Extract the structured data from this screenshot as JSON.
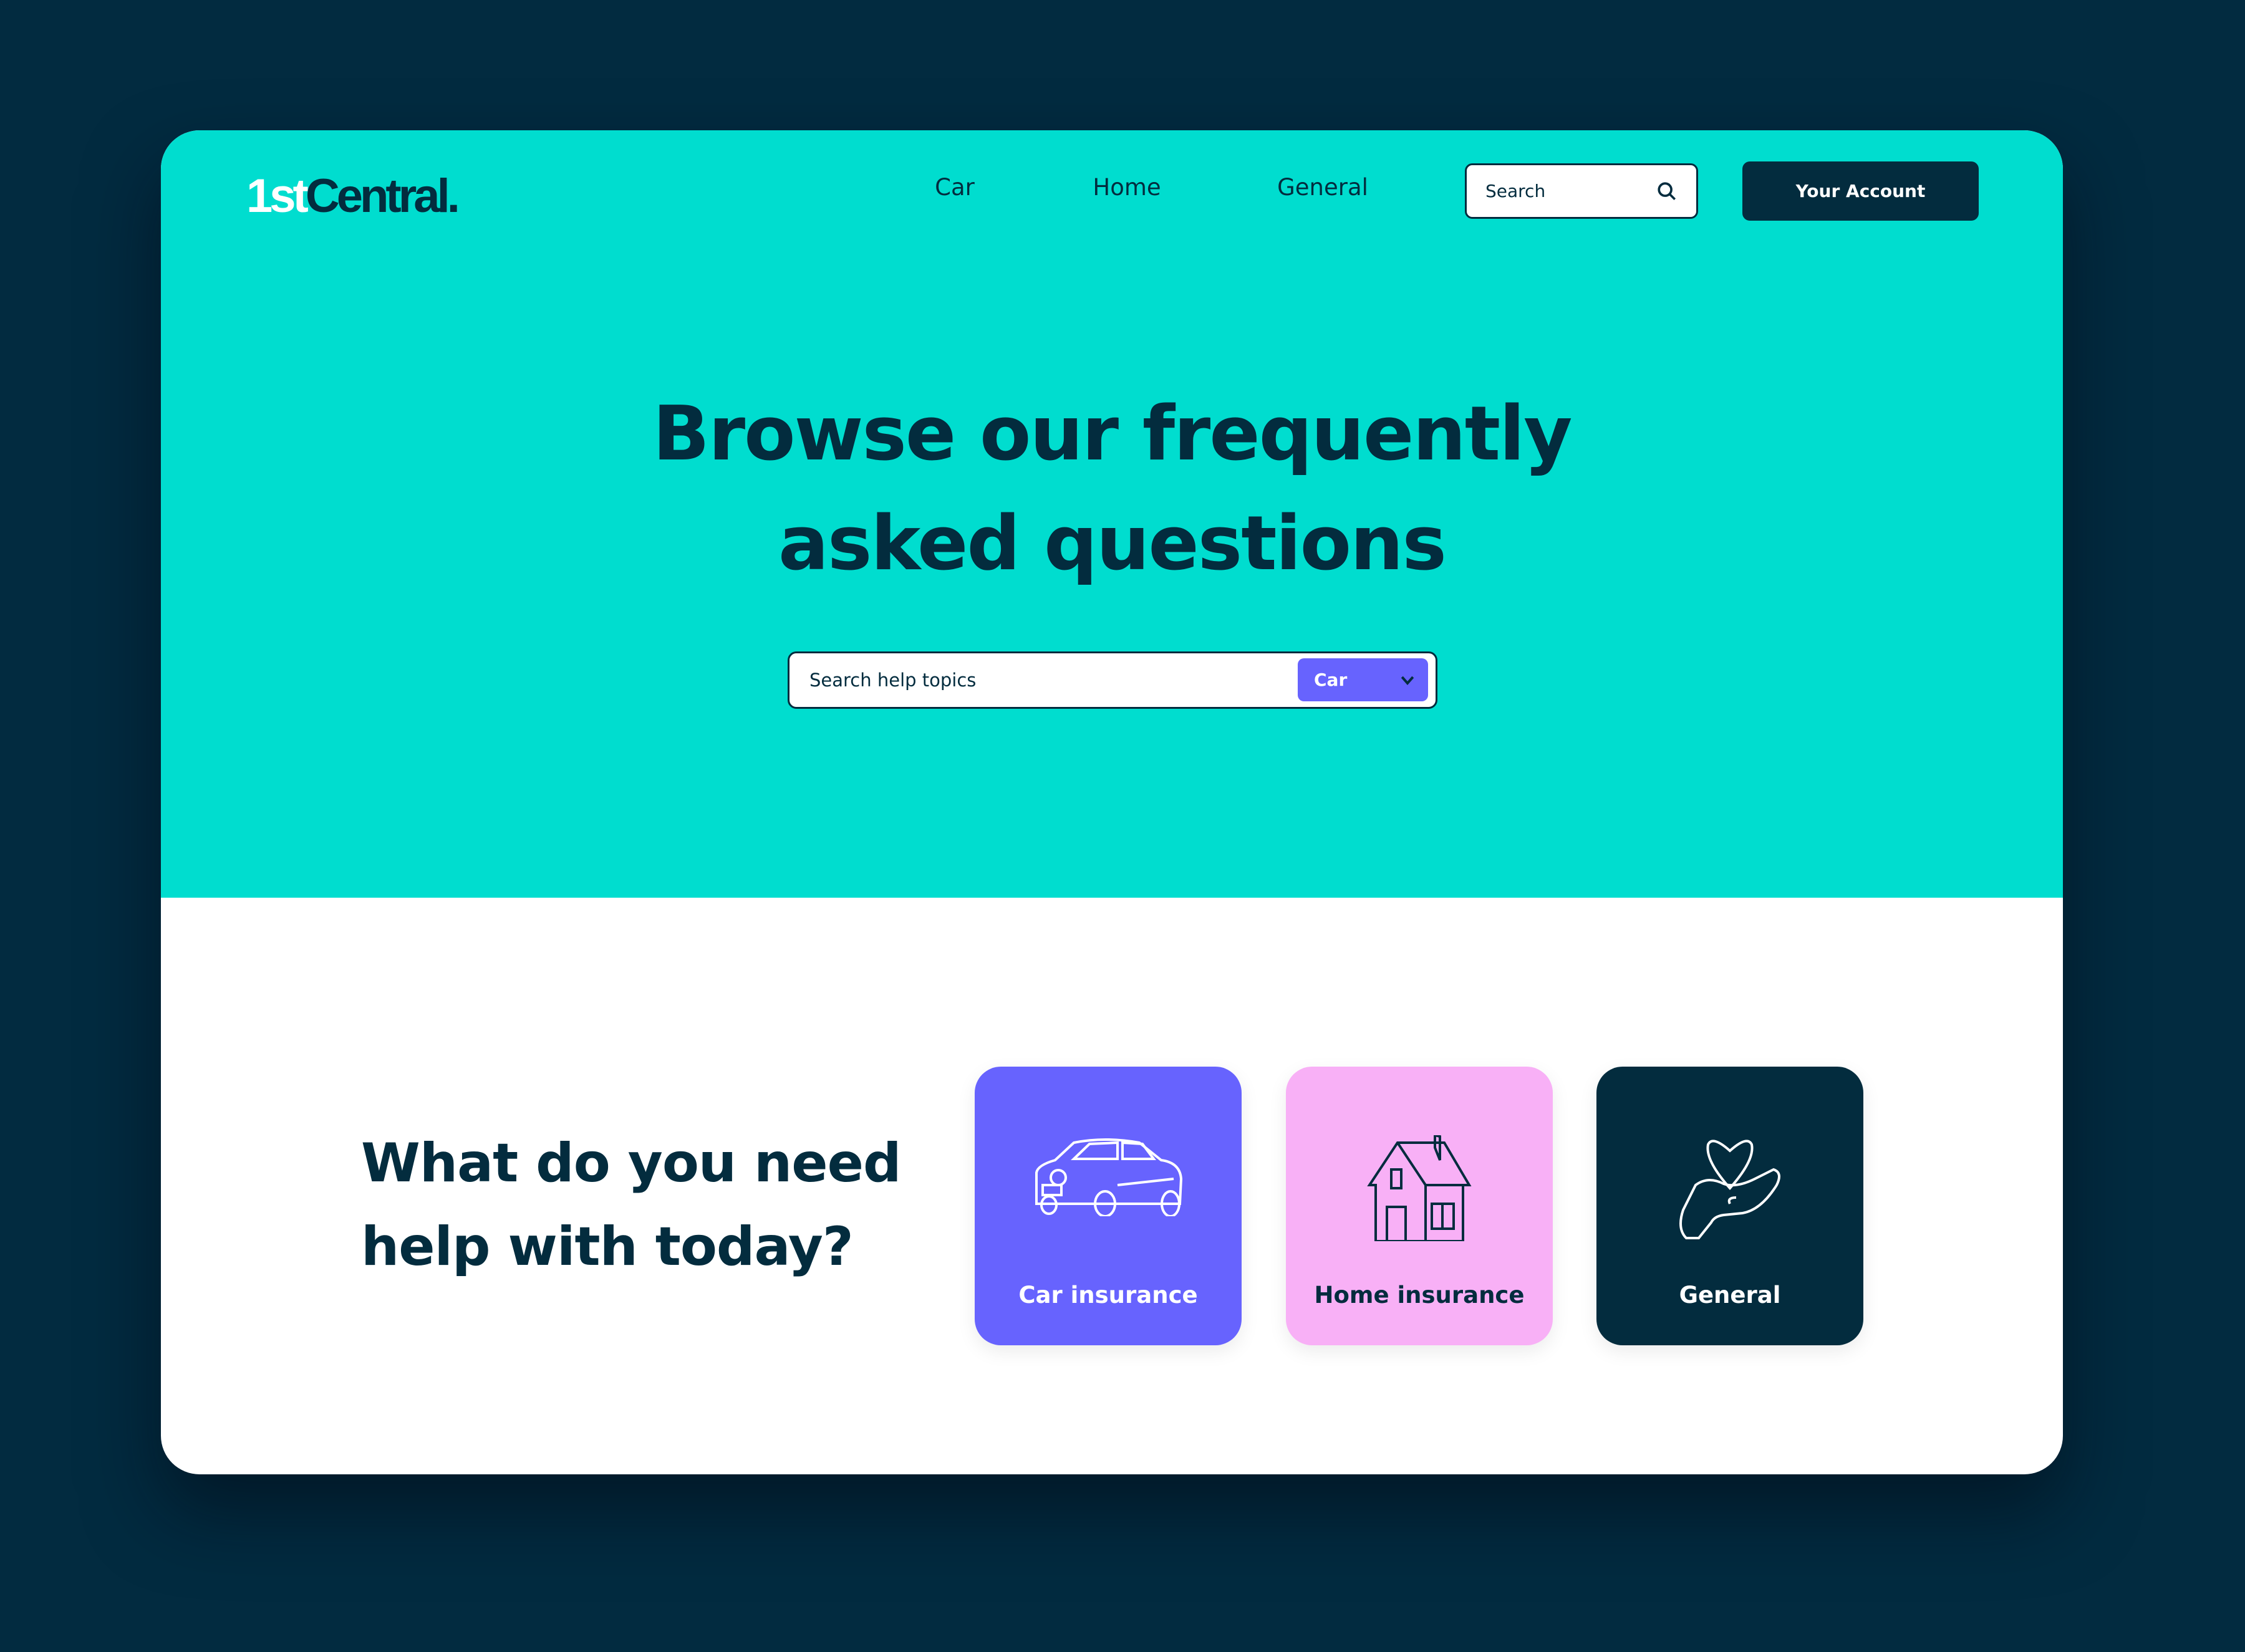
{
  "header": {
    "logo": {
      "part1": "1st",
      "part2": "Central."
    },
    "nav": [
      "Car",
      "Home",
      "General"
    ],
    "search_placeholder": "Search",
    "account_label": "Your Account"
  },
  "hero": {
    "title_line1": "Browse our frequently",
    "title_line2": "asked questions",
    "search_placeholder": "Search help topics",
    "category_selected": "Car"
  },
  "help": {
    "title_line1": "What do you need",
    "title_line2": "help with today?",
    "cards": [
      {
        "label": "Car insurance",
        "icon": "car-icon",
        "color": "#6763fe"
      },
      {
        "label": "Home insurance",
        "icon": "house-icon",
        "color": "#f8b0f6"
      },
      {
        "label": "General",
        "icon": "heart-hand-icon",
        "color": "#032c3e"
      }
    ]
  },
  "colors": {
    "background": "#022b40",
    "brand_teal": "#00ddcf",
    "navy": "#032c3e"
  }
}
